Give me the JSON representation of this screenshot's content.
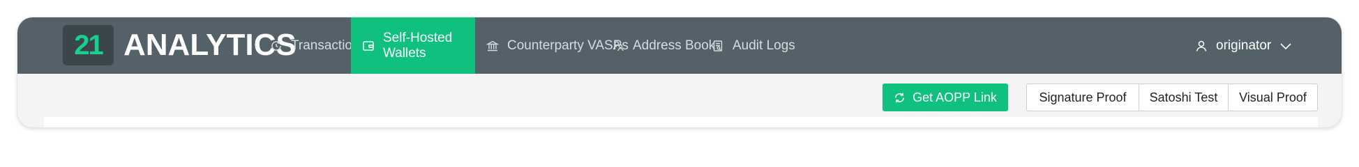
{
  "logo": {
    "badge": "21",
    "text": "ANALYTICS"
  },
  "nav": {
    "items": [
      {
        "label": "Transactions",
        "icon": "transactions-icon",
        "active": false
      },
      {
        "label": "Self-Hosted Wallets",
        "icon": "wallet-icon",
        "active": true
      },
      {
        "label": "Counterparty VASPs",
        "icon": "bank-icon",
        "active": false
      },
      {
        "label": "Address Book",
        "icon": "address-book-icon",
        "active": false
      },
      {
        "label": "Audit Logs",
        "icon": "audit-log-icon",
        "active": false
      }
    ],
    "user": {
      "name": "originator",
      "icon": "user-icon"
    }
  },
  "toolbar": {
    "aopp_label": "Get AOPP Link",
    "proof_buttons": [
      "Signature Proof",
      "Satoshi Test",
      "Visual Proof"
    ]
  },
  "colors": {
    "navbar": "#546168",
    "accent": "#10c07e",
    "logo_badge": "#3a464c",
    "logo_digits": "#18d08d"
  }
}
